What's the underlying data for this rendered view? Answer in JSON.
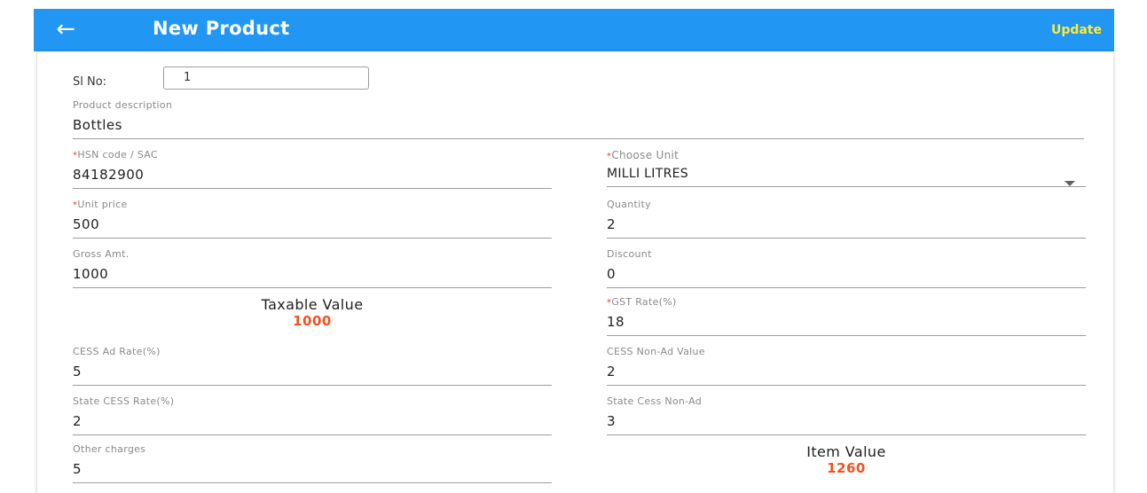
{
  "appbar": {
    "title": "New Product",
    "update_label": "Update",
    "back_icon": "←"
  },
  "form": {
    "sl_no_label": "Sl No:",
    "sl_no_value": "1",
    "product_description": {
      "label": "Product description",
      "value": "Bottles"
    },
    "hsn": {
      "label": "HSN code / SAC",
      "value": "84182900"
    },
    "unit": {
      "label": "Choose Unit",
      "value": "MILLI LITRES"
    },
    "unit_price": {
      "label": "Unit price",
      "value": "500"
    },
    "quantity": {
      "label": "Quantity",
      "value": "2"
    },
    "gross_amt": {
      "label": "Gross Amt.",
      "value": "1000"
    },
    "discount": {
      "label": "Discount",
      "value": "0"
    },
    "taxable": {
      "label": "Taxable Value",
      "value": "1000"
    },
    "gst_rate": {
      "label": "GST Rate(%)",
      "value": "18"
    },
    "cess_ad_rate": {
      "label": "CESS Ad Rate(%)",
      "value": "5"
    },
    "cess_non_ad": {
      "label": "CESS Non-Ad Value",
      "value": "2"
    },
    "state_cess_rate": {
      "label": "State CESS Rate(%)",
      "value": "2"
    },
    "state_cess_non_ad": {
      "label": "State Cess Non-Ad",
      "value": "3"
    },
    "other_charges": {
      "label": "Other charges",
      "value": "5"
    },
    "item_value": {
      "label": "Item Value",
      "value": "1260"
    }
  },
  "colors": {
    "appbar": "#2196f3",
    "update": "#ffeb3b",
    "accent_value": "#f4511e",
    "required": "#e53935"
  }
}
